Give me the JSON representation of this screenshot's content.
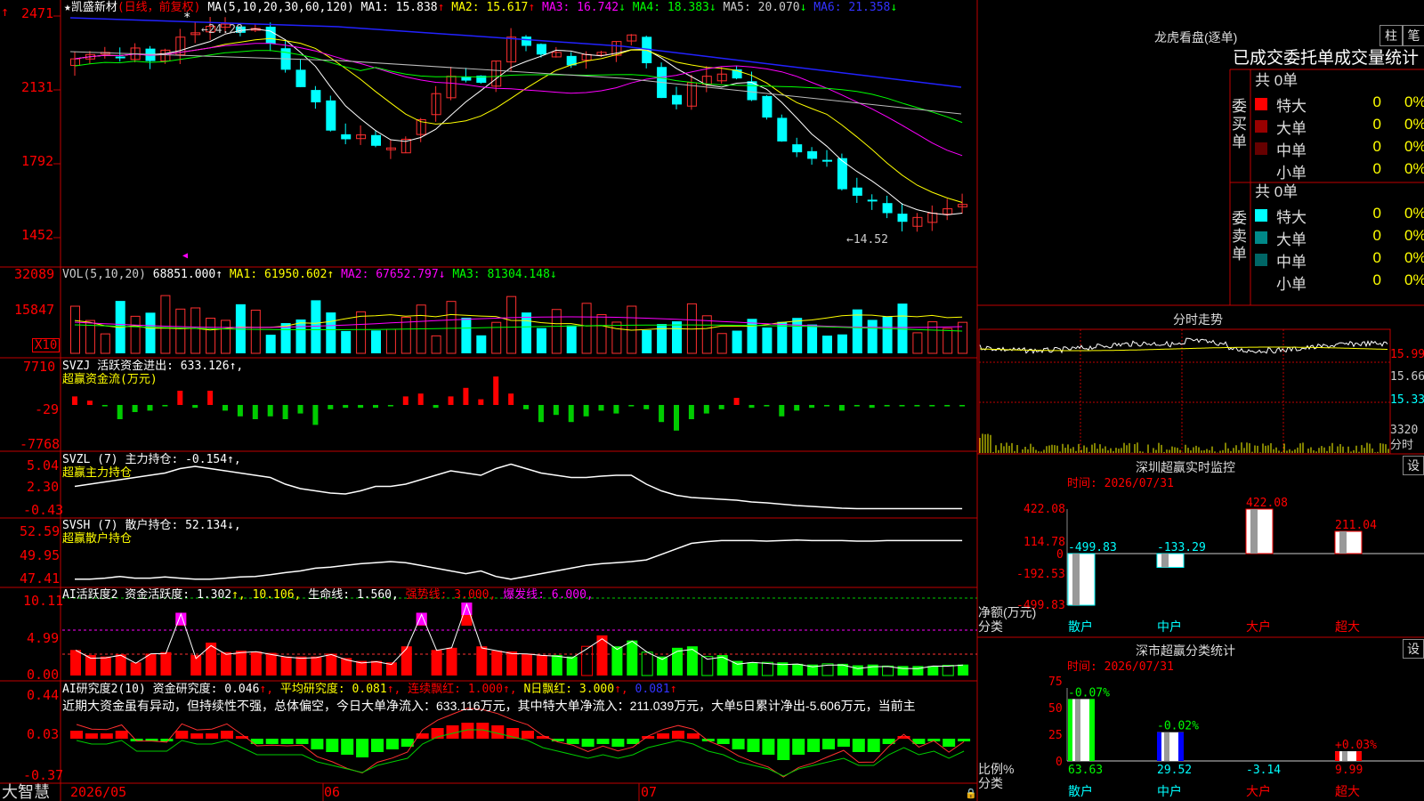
{
  "main_chart": {
    "stock_name": "★凯盛新材",
    "period_tag": "(日线，前复权)",
    "ma_params": "MA(5,10,20,30,60,120)",
    "ma_values": [
      {
        "label": "MA1: 15.838",
        "arrow": "↑",
        "color": "#ffffff"
      },
      {
        "label": "MA2: 15.617",
        "arrow": "↑",
        "color": "#ffff00"
      },
      {
        "label": "MA3: 16.742",
        "arrow": "↓",
        "color": "#ff00ff"
      },
      {
        "label": "MA4: 18.383",
        "arrow": "↓",
        "color": "#00ff00"
      },
      {
        "label": "MA5: 20.070",
        "arrow": "↓",
        "color": "#cccccc"
      },
      {
        "label": "MA6: 21.358",
        "arrow": "↓",
        "color": "#0000ff"
      }
    ],
    "y_ticks": [
      "2471",
      "2131",
      "1792",
      "1452"
    ],
    "high_marker": "←24.28",
    "low_marker": "←14.52",
    "high_value": 24.28,
    "low_value": 14.52
  },
  "volume_panel": {
    "params": "VOL(5,10,20)",
    "current": "68851.000↑",
    "ma_values": [
      {
        "label": "MA1: 61950.602↑",
        "color": "#ffff00"
      },
      {
        "label": "MA2: 67652.797↓",
        "color": "#ff00ff"
      },
      {
        "label": "MA3: 81304.148↓",
        "color": "#00ff00"
      }
    ],
    "y_ticks": [
      "32089",
      "15847"
    ],
    "unit_badge": "X10"
  },
  "svzj_panel": {
    "title": "SVZJ  活跃资金进出: 633.126↑,",
    "subtitle": "超赢资金流(万元)",
    "y_ticks": [
      "7710",
      "-29",
      "-7768"
    ]
  },
  "svzl_panel": {
    "title": "SVZL (7) 主力持仓: -0.154↑,",
    "subtitle": "超赢主力持仓",
    "y_ticks": [
      "5.04",
      "2.30",
      "-0.43"
    ]
  },
  "svsh_panel": {
    "title": "SVSH (7) 散户持仓: 52.134↓,",
    "subtitle": "超赢散户持仓",
    "y_ticks": [
      "52.59",
      "49.95",
      "47.41"
    ]
  },
  "ai_active_panel": {
    "title_parts": [
      {
        "text": "AI活跃度2 资金活跃度: 1.302",
        "color": "#ffffff"
      },
      {
        "text": "↑, 10.106,",
        "color": "#ffff00"
      },
      {
        "text": " 生命线: 1.560,",
        "color": "#ffffff"
      },
      {
        "text": " 强势线: 3.000,",
        "color": "#ff0000"
      },
      {
        "text": " 爆发线: 6.000,",
        "color": "#ff00ff"
      }
    ],
    "y_ticks": [
      "10.11",
      "4.99",
      "0.00"
    ]
  },
  "ai_research_panel": {
    "title_parts": [
      {
        "text": "AI研究度2(10) 资金研究度: 0.046",
        "color": "#ffffff"
      },
      {
        "text": "↑,",
        "color": "#ff0000"
      },
      {
        "text": " 平均研究度: 0.081",
        "color": "#ffff00"
      },
      {
        "text": "↑,",
        "color": "#ff0000"
      },
      {
        "text": " 连续飘红: 1.000",
        "color": "#ff0000"
      },
      {
        "text": "↑,",
        "color": "#ff0000"
      },
      {
        "text": " N日飘红: 3.000",
        "color": "#ffff00"
      },
      {
        "text": "↑,",
        "color": "#ff0000"
      },
      {
        "text": " 0.081",
        "color": "#0000ff"
      },
      {
        "text": "↑",
        "color": "#ff0000"
      }
    ],
    "commentary": "近期大资金虽有异动，但持续性不强，总体偏空，今日大单净流入：633.116万元，其中特大单净流入：211.039万元，大单5日累计净出-5.606万元，当前主",
    "y_ticks": [
      "0.44",
      "0.03",
      "-0.37"
    ]
  },
  "bottom_bar": {
    "brand": "大智慧",
    "date_labels": [
      "2026/05",
      "06",
      "07"
    ]
  },
  "right_panel": {
    "dragon_tiger": {
      "title": "龙虎看盘(逐单)",
      "buttons": [
        "柱",
        "笔"
      ],
      "header": "已成交委托单成交量统计",
      "buy_label": "委买单",
      "sell_label": "委卖单",
      "buy_total": "共 0单",
      "sell_total": "共 0单",
      "buy_rows": [
        {
          "name": "特大",
          "count": "0",
          "pct": "0%",
          "color": "#ff0000"
        },
        {
          "name": "大单",
          "count": "0",
          "pct": "0%",
          "color": "#990000"
        },
        {
          "name": "中单",
          "count": "0",
          "pct": "0%",
          "color": "#660000"
        },
        {
          "name": "小单",
          "count": "0",
          "pct": "0%",
          "color": "#000000"
        }
      ],
      "sell_rows": [
        {
          "name": "特大",
          "count": "0",
          "pct": "0%",
          "color": "#00ffff"
        },
        {
          "name": "大单",
          "count": "0",
          "pct": "0%",
          "color": "#008080"
        },
        {
          "name": "中单",
          "count": "0",
          "pct": "0%",
          "color": "#006666"
        },
        {
          "name": "小单",
          "count": "0",
          "pct": "0%",
          "color": "#000000"
        }
      ]
    },
    "intraday": {
      "title": "分时走势",
      "y_labels": [
        "15.99",
        "15.66",
        "15.33"
      ],
      "vol_label": "3320",
      "vol_unit": "分时"
    },
    "sz_monitor": {
      "title": "深圳超赢实时监控",
      "settings": "设",
      "time": "时间: 2026/07/31",
      "y_ticks": [
        "422.08",
        "114.78",
        "0",
        "-192.53",
        "-499.83"
      ],
      "axis_label_1": "净额(万元)",
      "axis_label_2": "分类",
      "categories": [
        "散户",
        "中户",
        "大户",
        "超大"
      ]
    },
    "sz_class": {
      "title": "深市超赢分类统计",
      "settings": "设",
      "time": "时间: 2026/07/31",
      "y_ticks": [
        "75",
        "50",
        "25",
        "0"
      ],
      "axis_label_1": "比例%",
      "axis_label_2": "分类",
      "categories": [
        "散户",
        "中户",
        "大户",
        "超大"
      ]
    }
  },
  "chart_data": [
    {
      "type": "bar",
      "title": "深圳超赢实时监控",
      "categories": [
        "散户",
        "中户",
        "大户",
        "超大"
      ],
      "values": [
        -499.83,
        -133.29,
        422.08,
        211.04
      ],
      "value_labels": [
        "-499.83",
        "-133.29",
        "422.08",
        "211.04"
      ],
      "ylim": [
        -499.83,
        422.08
      ],
      "xlabel": "分类",
      "ylabel": "净额(万元)"
    },
    {
      "type": "bar",
      "title": "深市超赢分类统计",
      "categories": [
        "散户",
        "中户",
        "大户",
        "超大"
      ],
      "values": [
        63.63,
        29.52,
        -3.14,
        9.99
      ],
      "value_labels": [
        "63.63",
        "29.52",
        "-3.14",
        "9.99"
      ],
      "change_labels": [
        "-0.07%",
        "-0.02%",
        "",
        "+0.03%"
      ],
      "ylim": [
        0,
        75
      ],
      "xlabel": "分类",
      "ylabel": "比例%"
    }
  ]
}
